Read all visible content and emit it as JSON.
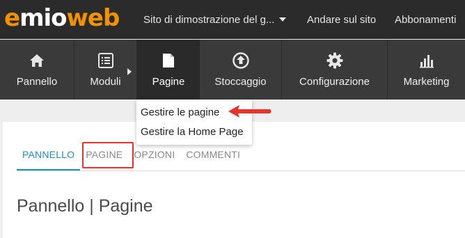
{
  "logo": {
    "part1": "e",
    "part2": "mio",
    "part3": "web"
  },
  "topbar": {
    "site_select": "Sito di dimostrazione del g...",
    "goto_site": "Andare sul sito",
    "subscriptions": "Abbonamenti"
  },
  "mainnav": {
    "items": [
      {
        "label": "Pannello",
        "icon": "home-icon"
      },
      {
        "label": "Moduli",
        "icon": "list-icon"
      },
      {
        "label": "Pagine",
        "icon": "page-icon",
        "active": true
      },
      {
        "label": "Stoccaggio",
        "icon": "upload-icon"
      },
      {
        "label": "Configurazione",
        "icon": "gear-icon"
      },
      {
        "label": "Marketing",
        "icon": "bar-chart-icon"
      }
    ]
  },
  "dropdown": {
    "items": [
      "Gestire le pagine",
      "Gestire la Home Page"
    ]
  },
  "tabs": [
    "PANNELLO",
    "PAGINE",
    "OPZIONI",
    "COMMENTI"
  ],
  "page_title": "Pannello | Pagine",
  "colors": {
    "brand_orange": "#f39200",
    "topbar_bg": "#2b2b2b",
    "nav_bg": "#3a3a3a",
    "active_tab_blue": "#1a8fcf",
    "annotation_red": "#e8322a"
  }
}
